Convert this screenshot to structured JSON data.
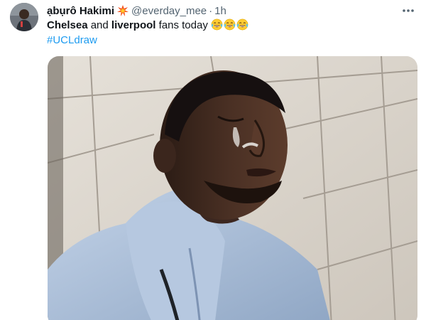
{
  "tweet": {
    "display_name": "ạbụrô Hakimi",
    "badge_emoji": "collision-emoji",
    "handle": "@everday_mee",
    "separator": "·",
    "timestamp": "1h",
    "text": {
      "word1": "Chelsea",
      "word2": " and ",
      "word3": "liverpool",
      "word4": " fans today",
      "emojis": [
        "face-with-tears-of-joy",
        "face-with-tears-of-joy",
        "face-with-tears-of-joy"
      ]
    },
    "hashtag": "#UCLdraw",
    "more_icon": "more-horizontal-icon",
    "media_description_icon": "photo-of-crying-man-in-hoodie"
  },
  "colors": {
    "text": "#0f1419",
    "secondary": "#536471",
    "link": "#1d9bf0",
    "hoodie": "#a9bdd8"
  }
}
